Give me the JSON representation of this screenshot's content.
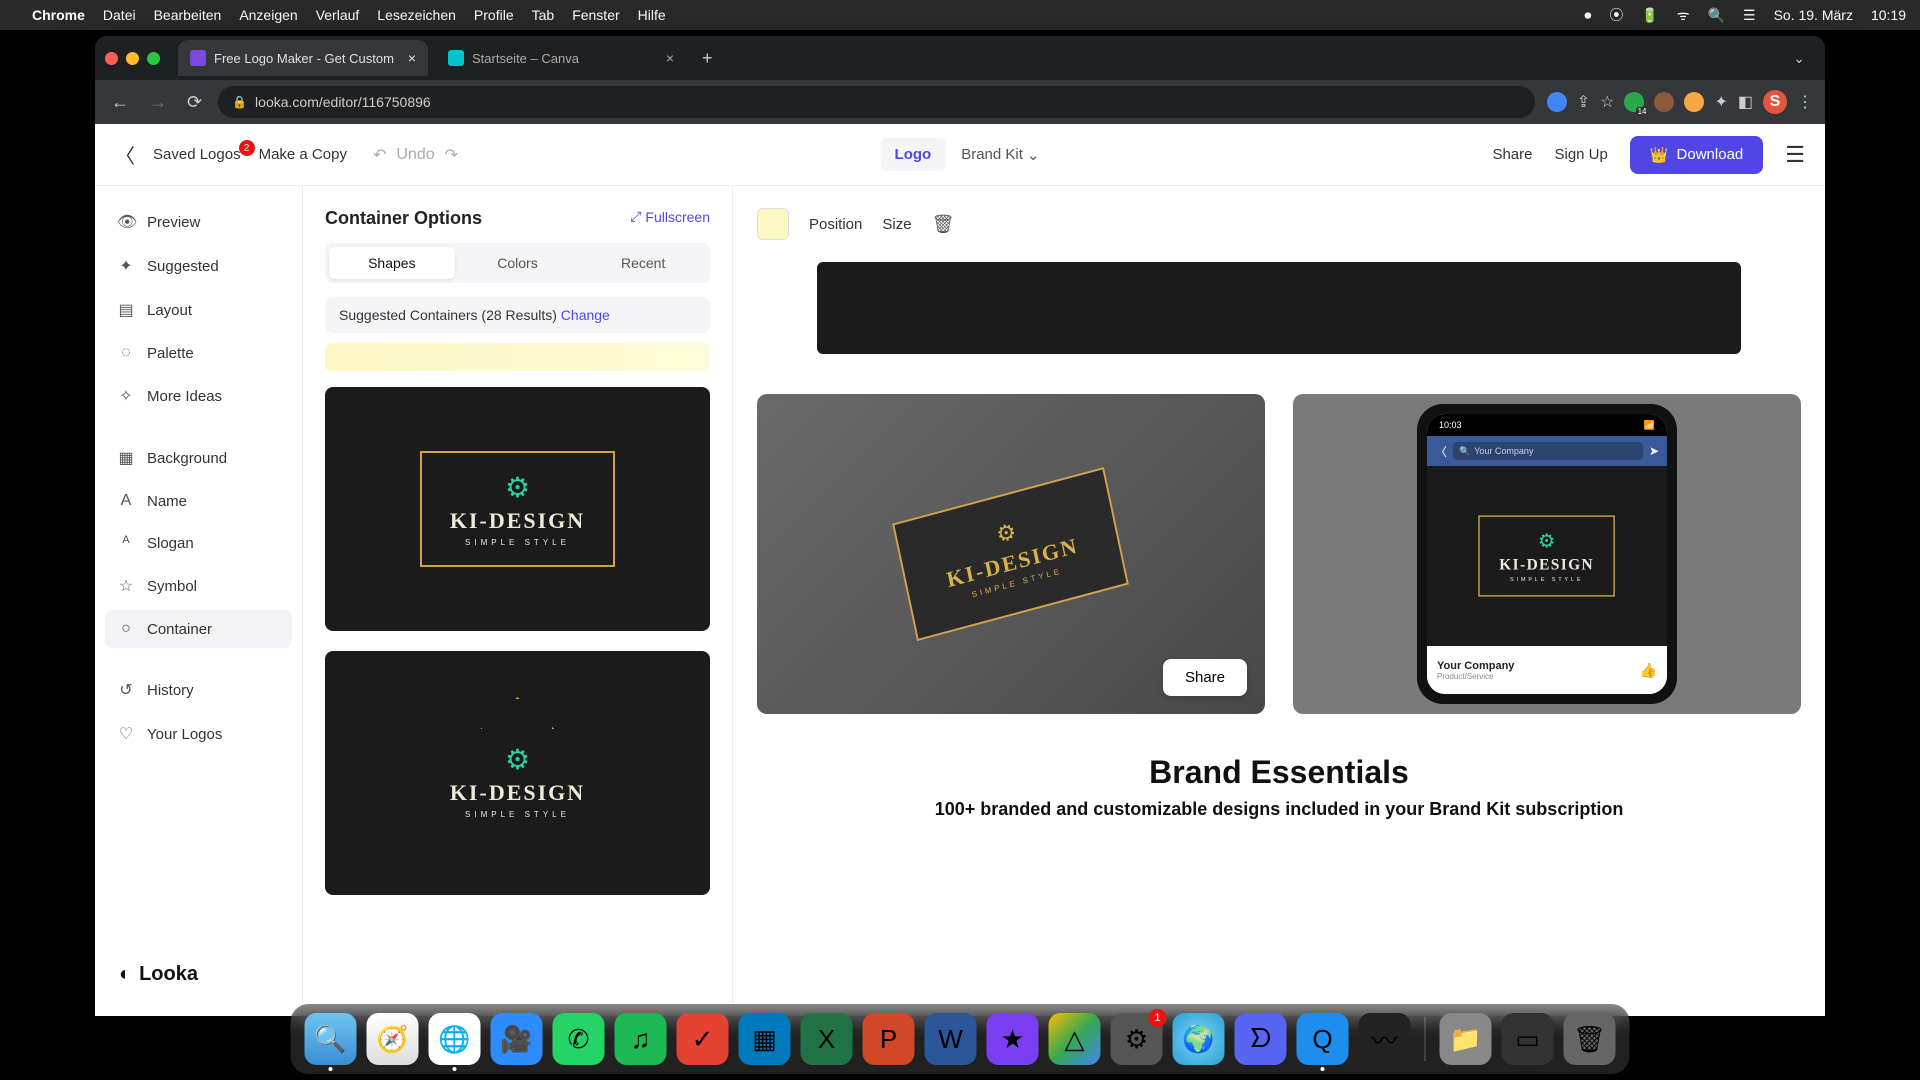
{
  "menubar": {
    "app": "Chrome",
    "items": [
      "Datei",
      "Bearbeiten",
      "Anzeigen",
      "Verlauf",
      "Lesezeichen",
      "Profile",
      "Tab",
      "Fenster",
      "Hilfe"
    ],
    "date": "So. 19. März",
    "time": "10:19"
  },
  "tabs": {
    "active": "Free Logo Maker - Get Custom",
    "inactive": "Startseite – Canva"
  },
  "url": "looka.com/editor/116750896",
  "header": {
    "saved_logos": "Saved Logos",
    "saved_badge": "2",
    "make_copy": "Make a Copy",
    "undo": "Undo",
    "logo": "Logo",
    "brand_kit": "Brand Kit",
    "share": "Share",
    "signup": "Sign Up",
    "download": "Download"
  },
  "leftnav": {
    "items": [
      "Preview",
      "Suggested",
      "Layout",
      "Palette",
      "More Ideas",
      "Background",
      "Name",
      "Slogan",
      "Symbol",
      "Container",
      "History",
      "Your Logos"
    ],
    "active_index": 9,
    "brand": "Looka"
  },
  "options": {
    "title": "Container Options",
    "fullscreen": "Fullscreen",
    "tabs": [
      "Shapes",
      "Colors",
      "Recent"
    ],
    "active_tab": 0,
    "suggested_label": "Suggested Containers (28 Results)",
    "change": "Change",
    "logo_text": "KI-DESIGN",
    "logo_slogan": "SIMPLE STYLE"
  },
  "canvas": {
    "position": "Position",
    "size": "Size",
    "share_btn": "Share",
    "phone_time": "10:03",
    "phone_search": "Your Company",
    "phone_company": "Your Company",
    "phone_sub": "Product/Service"
  },
  "essentials": {
    "title": "Brand Essentials",
    "sub": "100+ branded and customizable designs included in your Brand Kit subscription"
  },
  "ext_avatar": "S",
  "dock_badge": "1"
}
